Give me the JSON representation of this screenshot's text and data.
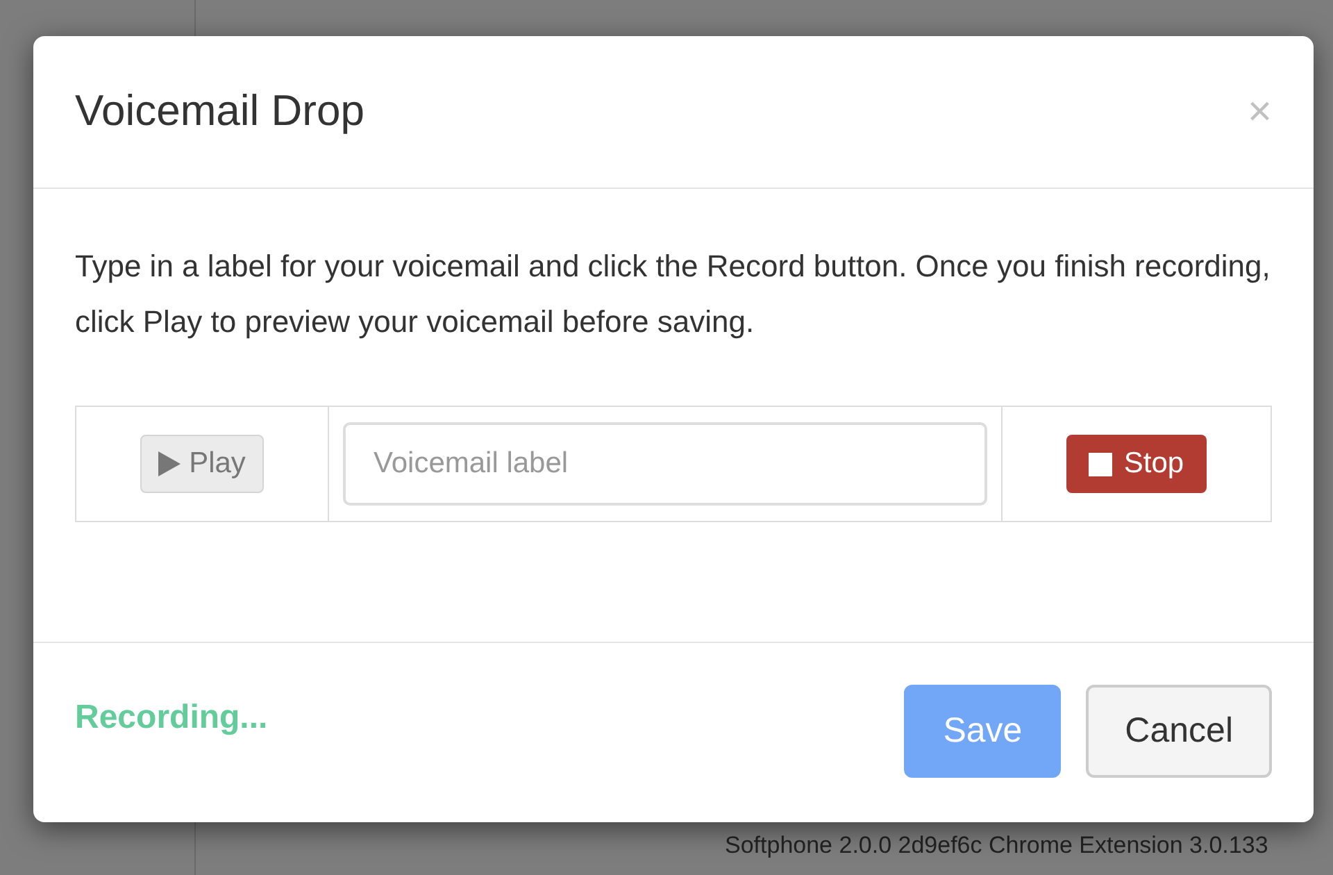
{
  "dialog": {
    "title": "Voicemail Drop",
    "close": "×",
    "instructions": "Type in a label for your voicemail and click the Record button. Once you finish recording, click Play to preview your voicemail before saving.",
    "play_button": {
      "label": "Play",
      "disabled": true
    },
    "label_field": {
      "placeholder": "Voicemail label"
    },
    "stop_button": {
      "label": "Stop"
    },
    "status": "Recording...",
    "buttons": [
      {
        "kind": "primary",
        "label": "Save",
        "disabled": true
      },
      {
        "kind": "default",
        "label": "Cancel",
        "disabled": false
      }
    ]
  },
  "footer": {
    "version": "Softphone 2.0.0 2d9ef6c Chrome Extension 3.0.133"
  }
}
